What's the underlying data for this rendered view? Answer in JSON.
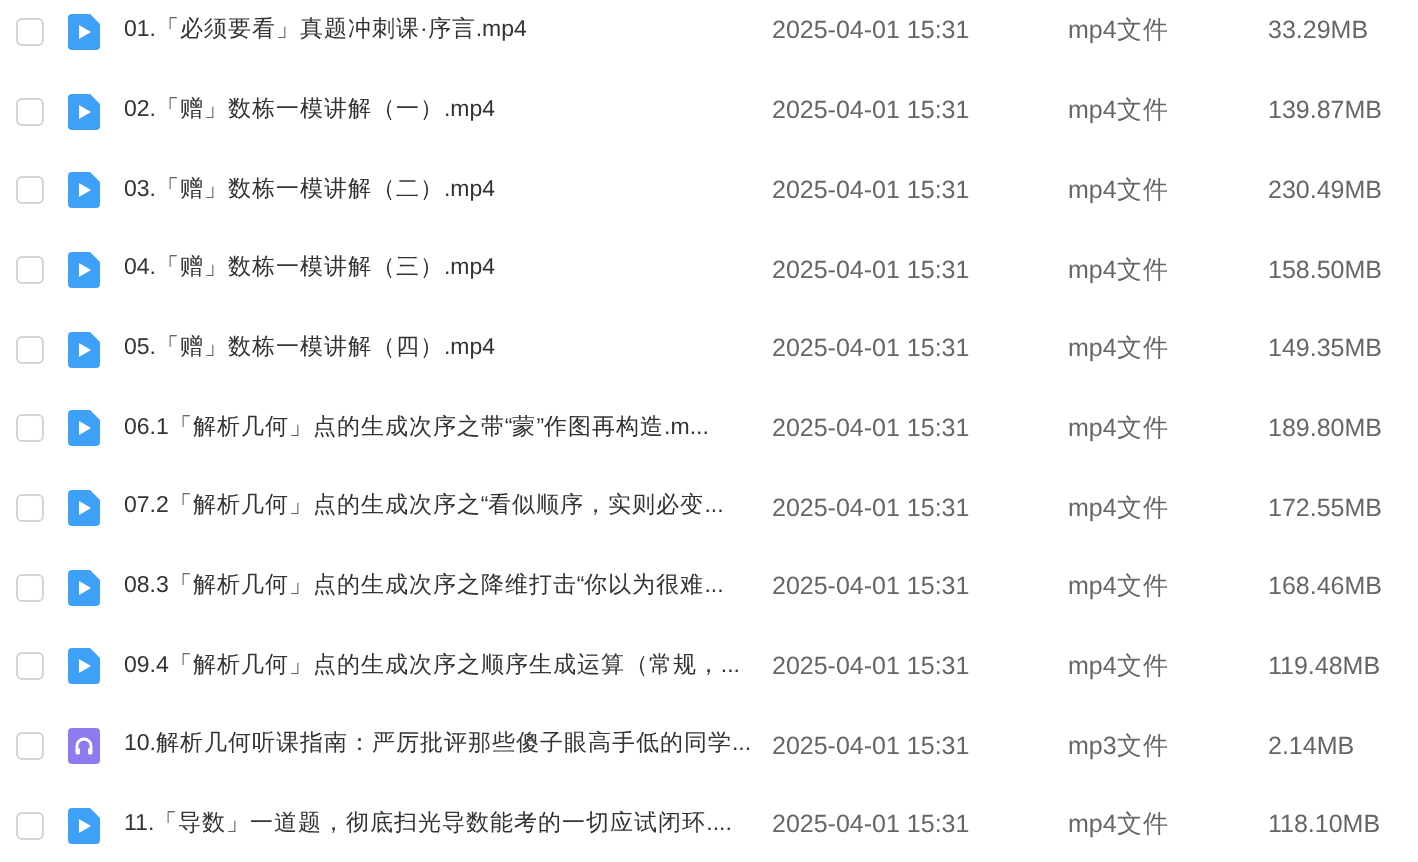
{
  "files": [
    {
      "kind": "video",
      "checked": false,
      "name": "01.「必须要看」真题冲刺课·序言.mp4",
      "date": "2025-04-01 15:31",
      "type": "mp4文件",
      "size": "33.29MB"
    },
    {
      "kind": "video",
      "checked": false,
      "name": "02.「赠」数栋一模讲解（一）.mp4",
      "date": "2025-04-01 15:31",
      "type": "mp4文件",
      "size": "139.87MB"
    },
    {
      "kind": "video",
      "checked": false,
      "name": "03.「赠」数栋一模讲解（二）.mp4",
      "date": "2025-04-01 15:31",
      "type": "mp4文件",
      "size": "230.49MB"
    },
    {
      "kind": "video",
      "checked": false,
      "name": "04.「赠」数栋一模讲解（三）.mp4",
      "date": "2025-04-01 15:31",
      "type": "mp4文件",
      "size": "158.50MB"
    },
    {
      "kind": "video",
      "checked": false,
      "name": "05.「赠」数栋一模讲解（四）.mp4",
      "date": "2025-04-01 15:31",
      "type": "mp4文件",
      "size": "149.35MB"
    },
    {
      "kind": "video",
      "checked": false,
      "name": "06.1「解析几何」点的生成次序之带“蒙”作图再构造.m...",
      "date": "2025-04-01 15:31",
      "type": "mp4文件",
      "size": "189.80MB"
    },
    {
      "kind": "video",
      "checked": false,
      "name": "07.2「解析几何」点的生成次序之“看似顺序，实则必变...",
      "date": "2025-04-01 15:31",
      "type": "mp4文件",
      "size": "172.55MB"
    },
    {
      "kind": "video",
      "checked": false,
      "name": "08.3「解析几何」点的生成次序之降维打击“你以为很难...",
      "date": "2025-04-01 15:31",
      "type": "mp4文件",
      "size": "168.46MB"
    },
    {
      "kind": "video",
      "checked": false,
      "name": "09.4「解析几何」点的生成次序之顺序生成运算（常规，...",
      "date": "2025-04-01 15:31",
      "type": "mp4文件",
      "size": "119.48MB"
    },
    {
      "kind": "audio",
      "checked": false,
      "name": "10.解析几何听课指南：严厉批评那些傻子眼高手低的同学...",
      "date": "2025-04-01 15:31",
      "type": "mp3文件",
      "size": "2.14MB"
    },
    {
      "kind": "video",
      "checked": false,
      "name": "11.「导数」一道题，彻底扫光导数能考的一切应试闭环....",
      "date": "2025-04-01 15:31",
      "type": "mp4文件",
      "size": "118.10MB"
    }
  ]
}
